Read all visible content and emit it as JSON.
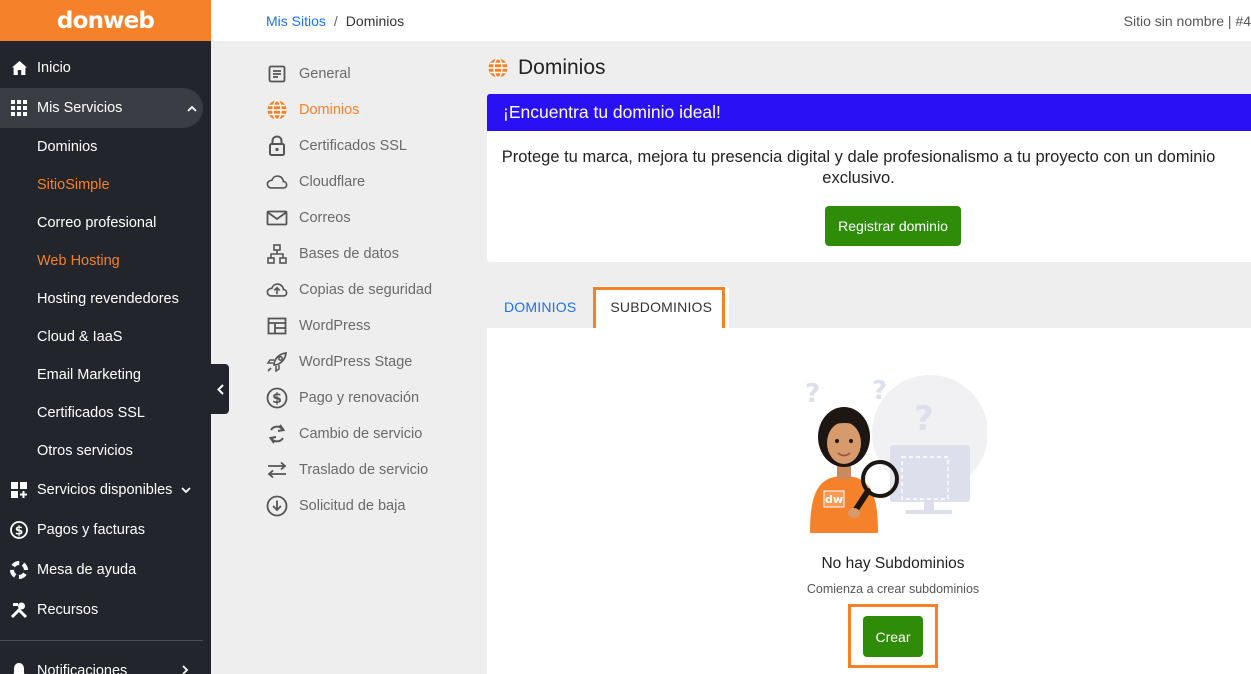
{
  "brand": {
    "logo": "donweb",
    "accent": "#f5812b",
    "sidebar_bg": "#22252b",
    "promo_bg": "#2a10f5",
    "button_green": "#2f8c08"
  },
  "sidebar": {
    "items": [
      {
        "label": "Inicio",
        "icon": "home-icon"
      },
      {
        "label": "Mis Servicios",
        "icon": "grid-icon",
        "expanded": true
      },
      {
        "label": "Servicios disponibles",
        "icon": "add-grid-icon"
      },
      {
        "label": "Pagos y facturas",
        "icon": "dollar-circle-icon"
      },
      {
        "label": "Mesa de ayuda",
        "icon": "lifebuoy-icon"
      },
      {
        "label": "Recursos",
        "icon": "tools-icon"
      },
      {
        "label": "Notificaciones",
        "icon": "bell-icon"
      }
    ],
    "services_sub": [
      {
        "label": "Dominios"
      },
      {
        "label": "SitioSimple"
      },
      {
        "label": "Correo profesional"
      },
      {
        "label": "Web Hosting"
      },
      {
        "label": "Hosting revendedores"
      },
      {
        "label": "Cloud & IaaS"
      },
      {
        "label": "Email Marketing"
      },
      {
        "label": "Certificados SSL"
      },
      {
        "label": "Otros servicios"
      }
    ]
  },
  "breadcrumb": {
    "parent": "Mis Sitios",
    "separator": "/",
    "current": "Dominios"
  },
  "site": {
    "name": "Sitio sin nombre | #4"
  },
  "submenu": [
    {
      "label": "General",
      "icon": "document-icon"
    },
    {
      "label": "Dominios",
      "icon": "globe-icon",
      "active": true
    },
    {
      "label": "Certificados SSL",
      "icon": "lock-icon"
    },
    {
      "label": "Cloudflare",
      "icon": "cloud-icon"
    },
    {
      "label": "Correos",
      "icon": "mail-icon"
    },
    {
      "label": "Bases de datos",
      "icon": "database-icon"
    },
    {
      "label": "Copias de seguridad",
      "icon": "cloud-upload-icon"
    },
    {
      "label": "WordPress",
      "icon": "layout-icon"
    },
    {
      "label": "WordPress Stage",
      "icon": "rocket-icon"
    },
    {
      "label": "Pago y renovación",
      "icon": "dollar-icon"
    },
    {
      "label": "Cambio de servicio",
      "icon": "refresh-icon"
    },
    {
      "label": "Traslado de servicio",
      "icon": "swap-icon"
    },
    {
      "label": "Solicitud de baja",
      "icon": "download-circle-icon"
    }
  ],
  "main": {
    "title": "Dominios",
    "promo": {
      "heading": "¡Encuentra tu dominio ideal!",
      "line1": "Protege tu marca, mejora tu presencia digital y dale profesionalismo a tu proyecto con un dominio",
      "line2": "exclusivo.",
      "button": "Registrar dominio"
    },
    "tabs": [
      {
        "label": "DOMINIOS"
      },
      {
        "label": "SUBDOMINIOS",
        "active": true
      }
    ],
    "empty": {
      "title": "No hay Subdominios",
      "subtitle": "Comienza a crear subdominios",
      "button": "Crear",
      "shirt_text": "dw"
    }
  }
}
